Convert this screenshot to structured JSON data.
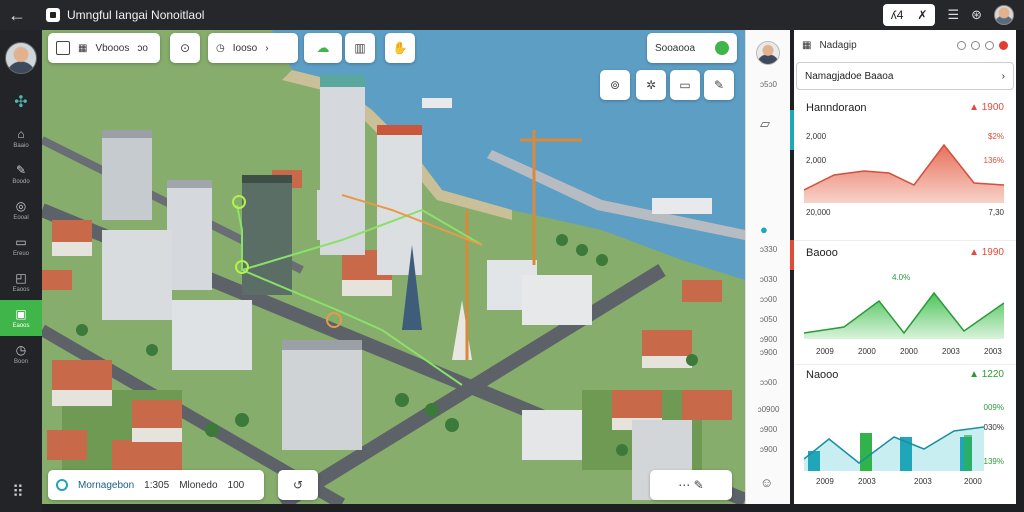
{
  "window": {
    "title": "Umngful Iangai Nonoitlaol"
  },
  "topbar": {
    "pill_left": "ʎ4",
    "pill_right": "✗"
  },
  "sidebar": {
    "items": [
      {
        "label": "",
        "icon": "drone-icon"
      },
      {
        "label": "Baaio",
        "icon": "home-icon"
      },
      {
        "label": "Boodo",
        "icon": "wrench-icon"
      },
      {
        "label": "Eooal",
        "icon": "target-icon"
      },
      {
        "label": "Ereuo",
        "icon": "monitor-icon"
      },
      {
        "label": "Eaoos",
        "icon": "chat-icon"
      },
      {
        "label": "Eaoos",
        "icon": "layers-icon",
        "active": true
      },
      {
        "label": "Boon",
        "icon": "clock-icon"
      }
    ]
  },
  "map": {
    "toolbar_top": {
      "label": "Vbooos",
      "value": "ɔo"
    },
    "toolbar_center": {
      "label": "Iooso"
    },
    "search_pill": {
      "label": "Sooaooa"
    },
    "bottom_bar": {
      "brand": "Mornagebon",
      "value1": "1:305",
      "label2": "Mlonedo",
      "value2": "100"
    }
  },
  "midcol": {
    "top_text": "ɔ5ɔ0",
    "values": [
      "ɔ330",
      "ɔ030",
      "ɔɔ00",
      "ɔ050",
      "ɔ900",
      "ɔ900",
      "ɔɔ00",
      "ɔ0900",
      "ɔ900",
      "ɔ900"
    ]
  },
  "panel": {
    "header_title": "Nadagip",
    "dropdown": "Namagjadoe Baaoa",
    "card1": {
      "title": "Hanndoraon",
      "stat": "1900",
      "y_labels": [
        "2,000",
        "2,000",
        "20,000"
      ],
      "r_labels": [
        "$2%",
        "136%",
        "7,30"
      ]
    },
    "card2": {
      "title": "Baooo",
      "stat": "1990",
      "peak_label": "4.0%",
      "x_labels": [
        "2009",
        "2000",
        "2000",
        "2003",
        "2003"
      ]
    },
    "card3": {
      "title": "Naooo",
      "stat": "1220",
      "r_labels": [
        "009%",
        "030%",
        "139%"
      ],
      "x_labels": [
        "2009",
        "2003",
        "2003",
        "2000"
      ]
    }
  },
  "colors": {
    "accent_green": "#3fb54a",
    "accent_red": "#e04b3a",
    "accent_teal": "#1fa6b9",
    "sidebar_bg": "#232428"
  }
}
